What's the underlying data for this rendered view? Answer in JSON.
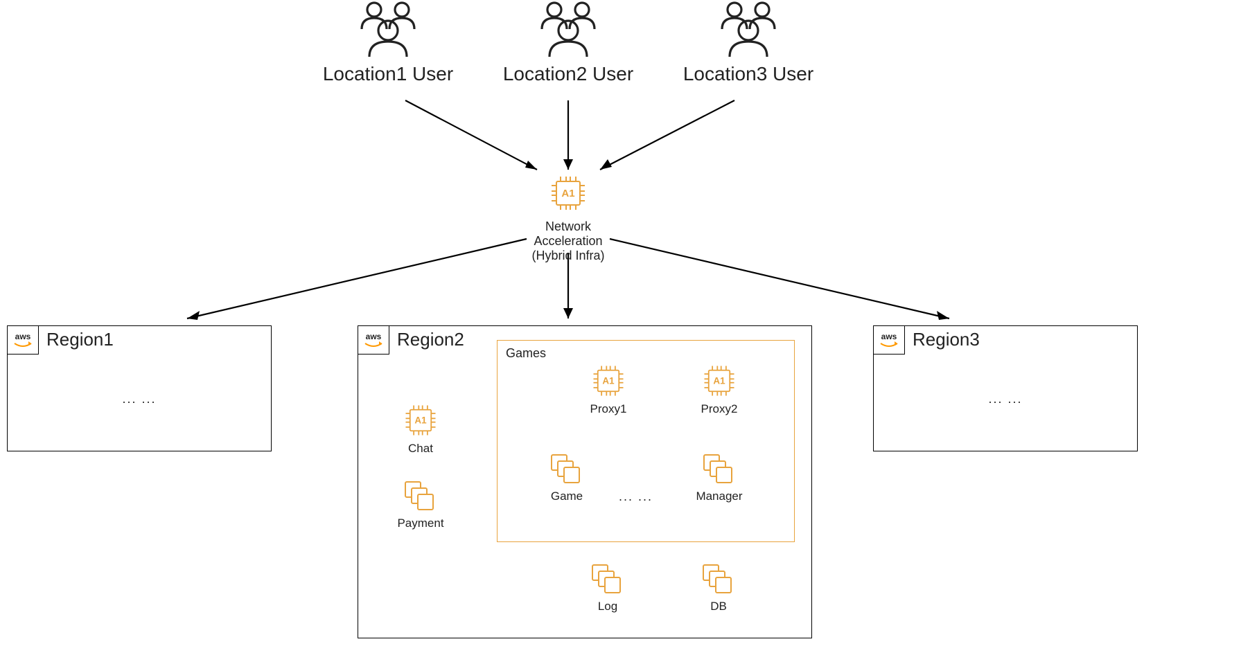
{
  "users": [
    {
      "label": "Location1 User"
    },
    {
      "label": "Location2 User"
    },
    {
      "label": "Location3 User"
    }
  ],
  "accelerator": {
    "chip_text": "A1",
    "line1": "Network Acceleration",
    "line2": "(Hybrid Infra)"
  },
  "regions": {
    "r1": {
      "title": "Region1",
      "content": "... ..."
    },
    "r2": {
      "title": "Region2"
    },
    "r3": {
      "title": "Region3",
      "content": "... ..."
    }
  },
  "aws_badge_text": "aws",
  "region2_nodes": {
    "chat": {
      "chip_text": "A1",
      "label": "Chat"
    },
    "payment": {
      "label": "Payment"
    },
    "proxy1": {
      "chip_text": "A1",
      "label": "Proxy1"
    },
    "proxy2": {
      "chip_text": "A1",
      "label": "Proxy2"
    },
    "game": {
      "label": "Game"
    },
    "manager": {
      "label": "Manager"
    },
    "log": {
      "label": "Log"
    },
    "db": {
      "label": "DB"
    },
    "games_title": "Games",
    "games_ellipsis": "... ..."
  }
}
